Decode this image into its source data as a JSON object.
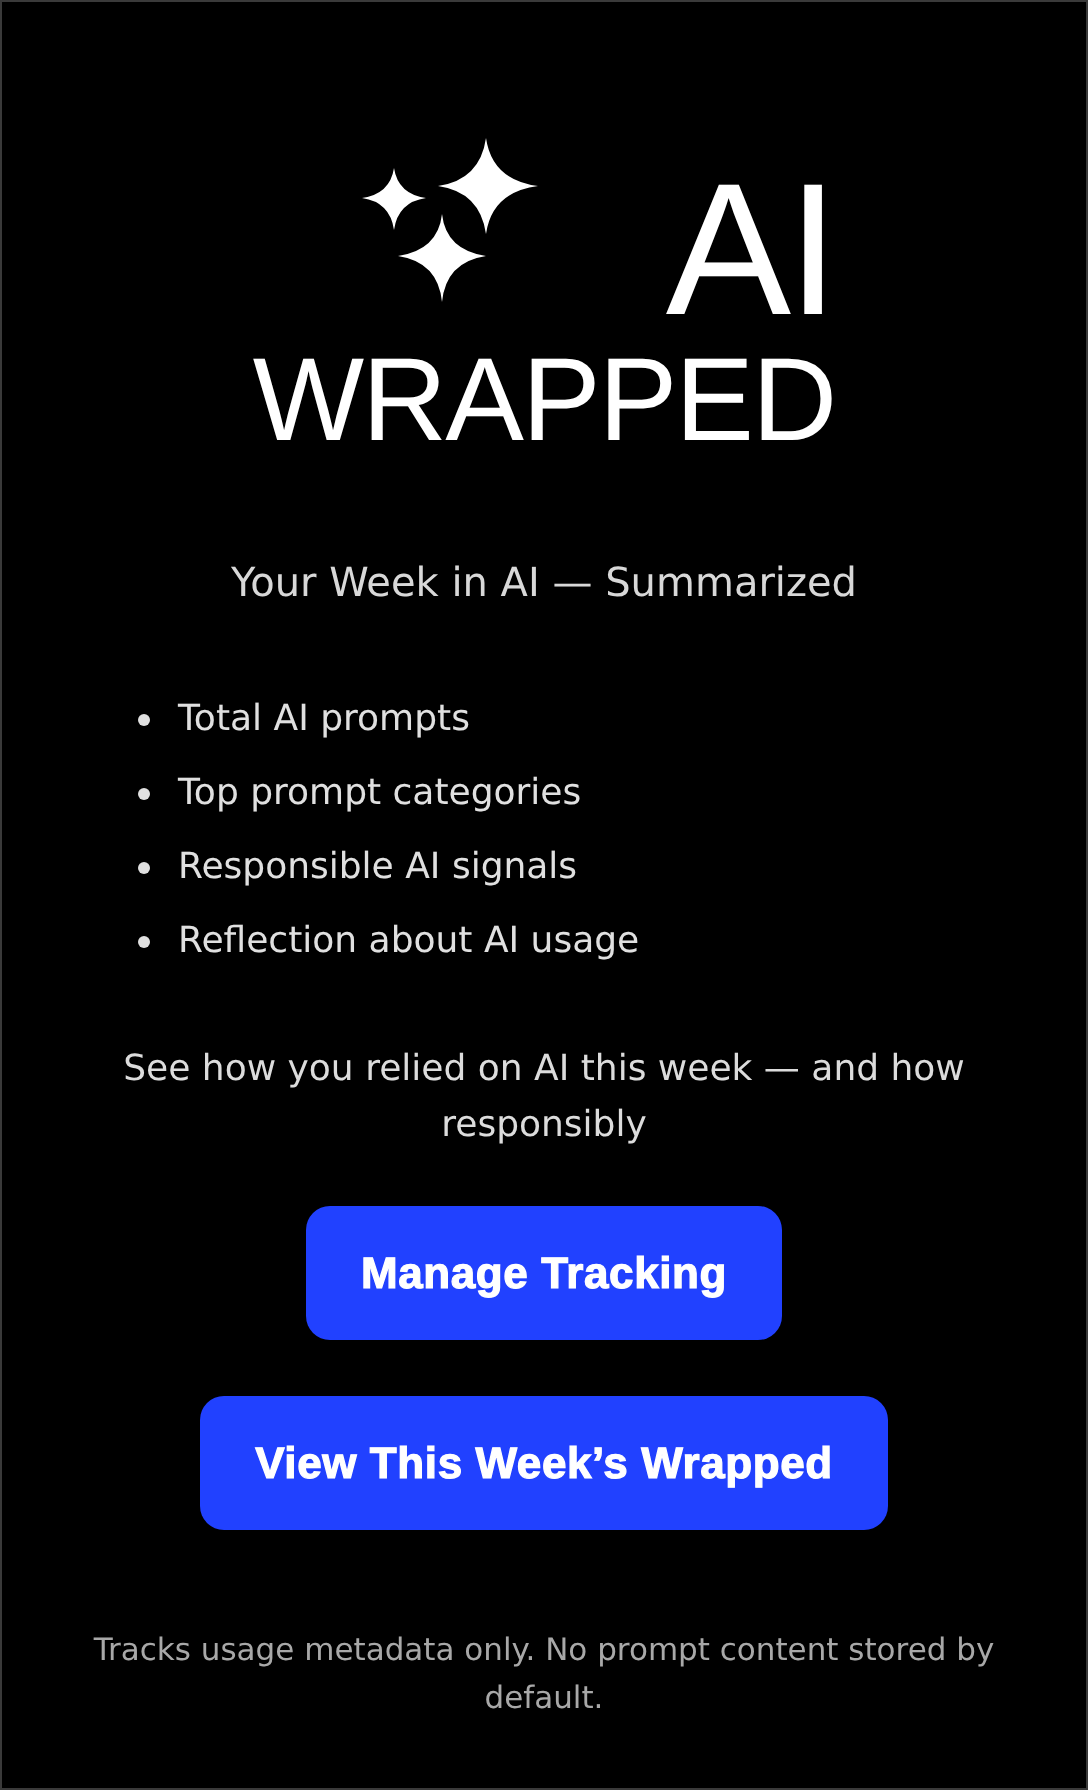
{
  "logo": {
    "title": "AI",
    "subtitle": "WRAPPED"
  },
  "tagline": "Your Week in AI — Summarized",
  "features": [
    "Total AI prompts",
    "Top prompt categories",
    "Responsible AI signals",
    "Reflection about AI usage"
  ],
  "description": "See how you relied on AI this week — and how responsibly",
  "buttons": [
    {
      "label": "Manage Tracking"
    },
    {
      "label": "View This Week’s Wrapped"
    }
  ],
  "footer": "Tracks usage metadata only. No prompt content stored by default."
}
